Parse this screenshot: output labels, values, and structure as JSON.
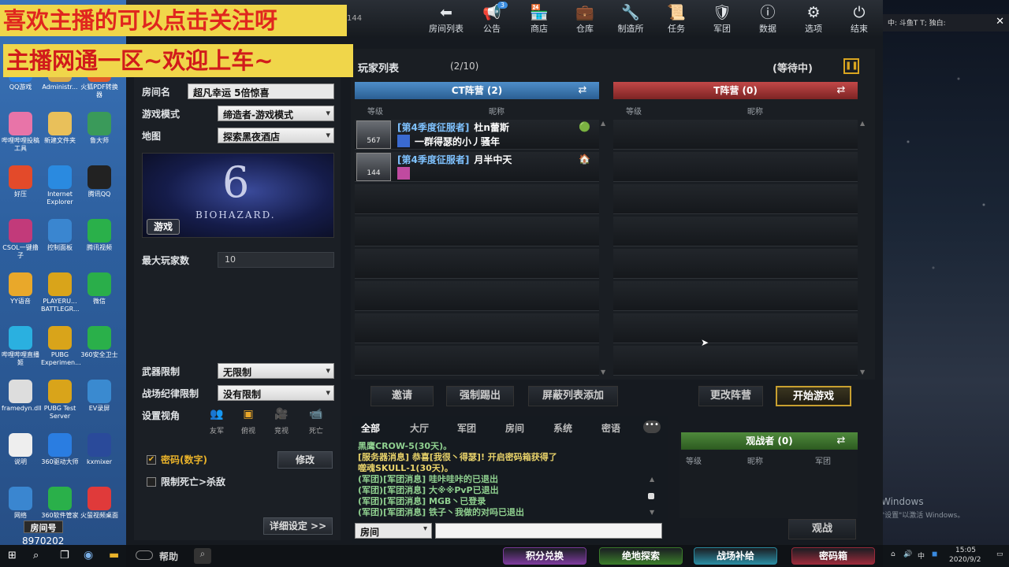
{
  "overlay": {
    "line1": "喜欢主播的可以点击关注呀",
    "line2": "主播网通一区~欢迎上车~"
  },
  "desktop_icons": [
    {
      "label": "QQ游戏",
      "color": "#2a7de1"
    },
    {
      "label": "Administr...",
      "color": "#d9a84a"
    },
    {
      "label": "火狐PDF转换器",
      "color": "#e05a2a"
    },
    {
      "label": "哔哩哔哩投稿工具",
      "color": "#e874a8"
    },
    {
      "label": "新建文件夹",
      "color": "#e9c05a"
    },
    {
      "label": "鲁大师",
      "color": "#3a9a5a"
    },
    {
      "label": "好压",
      "color": "#e34a2a"
    },
    {
      "label": "Internet Explorer",
      "color": "#2a8ae0"
    },
    {
      "label": "腾讯QQ",
      "color": "#222222"
    },
    {
      "label": "CSOL一键撸子",
      "color": "#c23a7a"
    },
    {
      "label": "控制面板",
      "color": "#3a86d0"
    },
    {
      "label": "腾讯视频",
      "color": "#2ab04a"
    },
    {
      "label": "YY语音",
      "color": "#e9a82a"
    },
    {
      "label": "PLAYERU... BATTLEGR...",
      "color": "#d9a41a"
    },
    {
      "label": "微信",
      "color": "#2aae4a"
    },
    {
      "label": "哔哩哔哩直播姬",
      "color": "#2ab0e0"
    },
    {
      "label": "PUBG Experimen...",
      "color": "#d9a41a"
    },
    {
      "label": "360安全卫士",
      "color": "#2ab04a"
    },
    {
      "label": "framedyn.dll",
      "color": "#dddddd"
    },
    {
      "label": "PUBG Test Server",
      "color": "#d9a41a"
    },
    {
      "label": "EV录屏",
      "color": "#3a8ad0"
    },
    {
      "label": "说明",
      "color": "#eeeeee"
    },
    {
      "label": "360驱动大师",
      "color": "#2a7de1"
    },
    {
      "label": "kxmixer",
      "color": "#2a4a9a"
    },
    {
      "label": "网络",
      "color": "#3a86d0"
    },
    {
      "label": "360软件管家",
      "color": "#2ab04a"
    },
    {
      "label": "火萤视频桌面",
      "color": "#e03a3a"
    }
  ],
  "desktop_badge": {
    "room_label": "房间号",
    "room_id": "8970202"
  },
  "topbar": {
    "room_num": "144",
    "items": [
      {
        "label": "房间列表",
        "icon": "back-arrow-icon",
        "glyph": "⬅"
      },
      {
        "label": "公告",
        "icon": "megaphone-icon",
        "glyph": "📢",
        "badge": "3"
      },
      {
        "label": "商店",
        "icon": "shop-icon",
        "glyph": "🏪"
      },
      {
        "label": "仓库",
        "icon": "bag-icon",
        "glyph": "💼"
      },
      {
        "label": "制造所",
        "icon": "wrench-icon",
        "glyph": "🔧"
      },
      {
        "label": "任务",
        "icon": "task-icon",
        "glyph": "📜"
      },
      {
        "label": "军团",
        "icon": "shield-icon",
        "glyph": "🛡"
      },
      {
        "label": "数据",
        "icon": "info-icon",
        "glyph": "ⓘ"
      },
      {
        "label": "选项",
        "icon": "gear-icon",
        "glyph": "⚙"
      },
      {
        "label": "结束",
        "icon": "power-icon",
        "glyph": "⏻"
      }
    ]
  },
  "window_bar": {
    "text": "中: 斗鱼T T; 独白:",
    "close": "✕"
  },
  "room": {
    "name_label": "房间名",
    "name_value": "超凡幸运 5倍惊喜",
    "mode_label": "游戏模式",
    "mode_value": "缔造者-游戏模式",
    "map_label": "地图",
    "map_value": "探索黑夜酒店",
    "map_image": {
      "number": "6",
      "title": "BIOHAZARD.",
      "button": "游戏"
    },
    "maxp_label": "最大玩家数",
    "maxp_value": "10",
    "weapon_label": "武器限制",
    "weapon_value": "无限制",
    "disc_label": "战场纪律限制",
    "disc_value": "没有限制",
    "view_label": "设置视角",
    "views": [
      {
        "label": "友军",
        "icon": "friends-view-icon",
        "glyph": "👥"
      },
      {
        "label": "俯视",
        "icon": "topdown-view-icon",
        "glyph": "▣"
      },
      {
        "label": "竞视",
        "icon": "camera-view-icon",
        "glyph": "🎥"
      },
      {
        "label": "死亡",
        "icon": "death-cam-icon",
        "glyph": "📹"
      }
    ],
    "password_label": "密码(数字)",
    "password_checked": true,
    "modify_button": "修改",
    "deathlimit_label": "限制死亡>杀敌",
    "deathlimit_checked": false,
    "detail_button": "详细设定 >>"
  },
  "player_list": {
    "title": "玩家列表",
    "count": "(2/10)",
    "status": "(等待中)",
    "ct_team": "CT阵营 (2)",
    "t_team": "T阵营 (0)",
    "col_level": "等级",
    "col_name": "昵称",
    "ct_players": [
      {
        "rank": "567",
        "tag": "[第4季度征服者]",
        "name": "杜n蕾斯",
        "clan": "一群得瑟的小丿骚年",
        "status_icon": "🟢",
        "clan_color": "#3a6ad0"
      },
      {
        "rank": "144",
        "tag": "[第4季度征服者]",
        "name": "月半中天",
        "clan": "",
        "status_icon": "🏠",
        "clan_color": "#c04aa0"
      }
    ]
  },
  "actions": {
    "invite": "邀请",
    "kick": "强制踢出",
    "block": "屏蔽列表添加",
    "change_team": "更改阵营",
    "start": "开始游戏"
  },
  "chat": {
    "tabs": [
      "全部",
      "大厅",
      "军团",
      "房间",
      "系统",
      "密语"
    ],
    "lines": [
      {
        "text": "黑鹰CROW-5(30天)。",
        "color": "#8fd08f"
      },
      {
        "text": "[服务器消息] 恭喜[我很丶得瑟]! 开启密码箱获得了",
        "color": "#e9d36a"
      },
      {
        "text": "噬魂SKULL-1(30天)。",
        "color": "#e9d36a"
      },
      {
        "text": "(军团)[军团消息] 哇咔哇咔的已退出",
        "color": "#8fd08f"
      },
      {
        "text": "(军团)[军团消息] 大※※PvP已退出",
        "color": "#8fd08f"
      },
      {
        "text": "(军团)[军团消息] MGB丶已登录",
        "color": "#8fd08f"
      },
      {
        "text": "(军团)[军团消息] 铁子丶我做的对吗已退出",
        "color": "#8fd08f"
      }
    ],
    "channel": "房间"
  },
  "spectator": {
    "title": "观战者 (0)",
    "col_level": "等级",
    "col_name": "昵称",
    "col_clan": "军团",
    "button": "观战"
  },
  "footer": {
    "help": "帮助",
    "buttons": [
      {
        "label": "积分兑换",
        "color": "#7a3a9a"
      },
      {
        "label": "绝地探索",
        "color": "#3a7a2a"
      },
      {
        "label": "战场补给",
        "color": "#2a8aa0"
      },
      {
        "label": "密码箱",
        "color": "#9a2a3a"
      }
    ]
  },
  "watermark": {
    "line1": "Windows",
    "line2": "\"设置\"以激活 Windows。"
  },
  "tray": {
    "time": "15:05",
    "date": "2020/9/2",
    "ime": "中"
  }
}
